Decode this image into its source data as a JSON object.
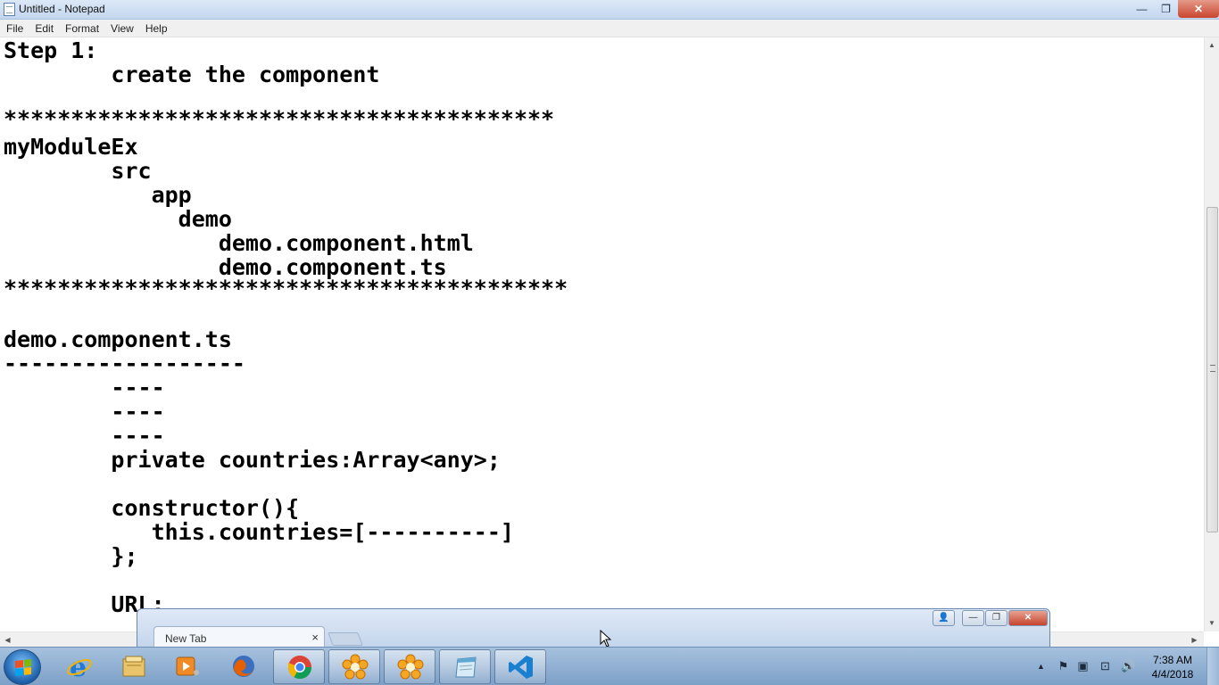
{
  "window": {
    "title": "Untitled - Notepad",
    "controls": {
      "minimize": "—",
      "maximize": "❐",
      "close": "✕"
    }
  },
  "menubar": {
    "items": [
      "File",
      "Edit",
      "Format",
      "View",
      "Help"
    ]
  },
  "editor": {
    "lines": [
      "Step 1:",
      "        create the component",
      "",
      "*****************************************",
      "myModuleEx",
      "        src",
      "           app",
      "             demo",
      "                demo.component.html",
      "                demo.component.ts",
      "******************************************",
      "",
      "demo.component.ts",
      "------------------",
      "        ----",
      "        ----",
      "        ----",
      "        private countries:Array<any>;",
      "",
      "        constructor(){",
      "           this.countries=[----------]",
      "        };",
      "",
      "        URL:"
    ]
  },
  "browser": {
    "tab_title": "New Tab",
    "tab_close": "×",
    "controls": {
      "user": "👤",
      "minimize": "—",
      "maximize": "❐",
      "close": "✕"
    }
  },
  "taskbar": {
    "apps": [
      {
        "name": "internet-explorer-icon",
        "color": "#1f7ad6"
      },
      {
        "name": "file-explorer-icon",
        "color": "#e9c46a"
      },
      {
        "name": "media-player-icon",
        "color": "#f08a24"
      },
      {
        "name": "firefox-icon",
        "color": "#e66000"
      },
      {
        "name": "chrome-icon",
        "color": "#db4437",
        "active": true
      },
      {
        "name": "flower-app-icon",
        "color": "#f5a623",
        "active": true
      },
      {
        "name": "flower-app-icon-2",
        "color": "#f5a623",
        "active": true
      },
      {
        "name": "notepad-app-icon",
        "color": "#5fa8d3",
        "active": true
      },
      {
        "name": "vscode-icon",
        "color": "#1b7fd0",
        "active": true
      }
    ],
    "clock": {
      "time": "7:38 AM",
      "date": "4/4/2018"
    },
    "tray_arrow": "▲"
  }
}
